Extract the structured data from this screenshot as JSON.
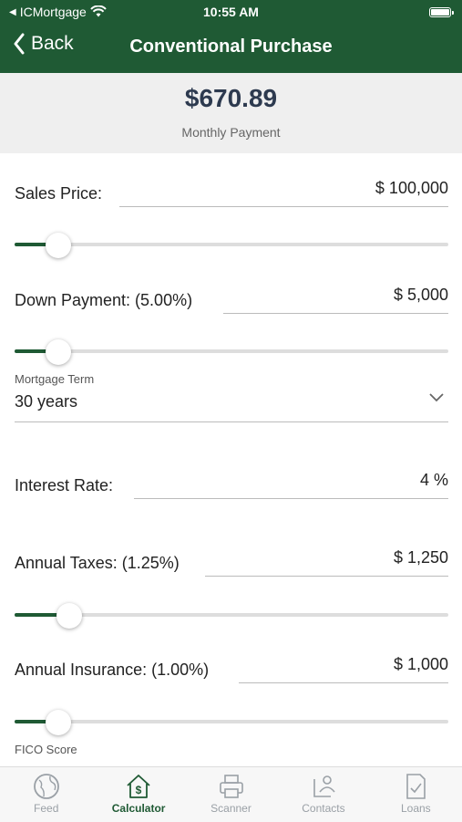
{
  "status_bar": {
    "back_app": "ICMortgage",
    "time": "10:55 AM"
  },
  "nav": {
    "back_label": "Back",
    "title": "Conventional Purchase"
  },
  "summary": {
    "amount": "$670.89",
    "label": "Monthly Payment"
  },
  "fields": {
    "sales_price": {
      "label": "Sales Price:",
      "value": "$ 100,000",
      "slider_fraction": 0.1
    },
    "down_payment": {
      "label": "Down Payment: (5.00%)",
      "value": "$ 5,000",
      "slider_fraction": 0.1
    },
    "mortgage_term": {
      "label": "Mortgage Term",
      "value": "30 years"
    },
    "interest_rate": {
      "label": "Interest Rate:",
      "value": "4 %"
    },
    "annual_taxes": {
      "label": "Annual Taxes: (1.25%)",
      "value": "$ 1,250",
      "slider_fraction": 0.125
    },
    "annual_insurance": {
      "label": "Annual Insurance: (1.00%)",
      "value": "$ 1,000",
      "slider_fraction": 0.1
    },
    "fico_score": {
      "label": "FICO Score"
    }
  },
  "tabs": [
    {
      "label": "Feed",
      "icon": "globe-icon"
    },
    {
      "label": "Calculator",
      "icon": "calculator-house-icon",
      "active": true
    },
    {
      "label": "Scanner",
      "icon": "printer-icon"
    },
    {
      "label": "Contacts",
      "icon": "contacts-icon"
    },
    {
      "label": "Loans",
      "icon": "document-check-icon"
    }
  ],
  "colors": {
    "header": "#1f5a34",
    "accent": "#1f5a34",
    "amount": "#2d3a4f"
  }
}
